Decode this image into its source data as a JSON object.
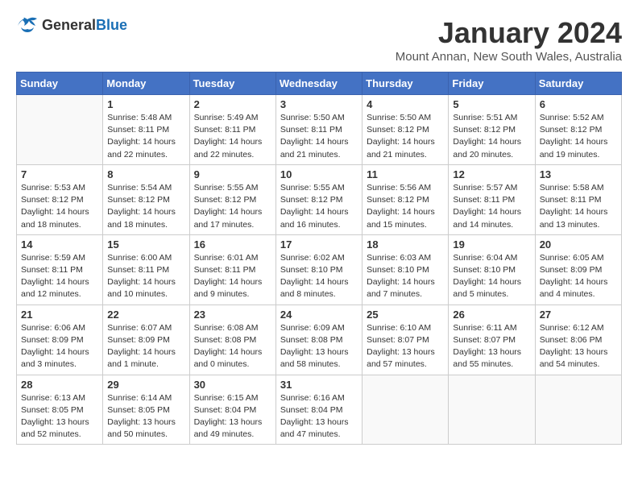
{
  "logo": {
    "general": "General",
    "blue": "Blue"
  },
  "title": "January 2024",
  "location": "Mount Annan, New South Wales, Australia",
  "days_of_week": [
    "Sunday",
    "Monday",
    "Tuesday",
    "Wednesday",
    "Thursday",
    "Friday",
    "Saturday"
  ],
  "weeks": [
    [
      {
        "day": "",
        "info": ""
      },
      {
        "day": "1",
        "info": "Sunrise: 5:48 AM\nSunset: 8:11 PM\nDaylight: 14 hours\nand 22 minutes."
      },
      {
        "day": "2",
        "info": "Sunrise: 5:49 AM\nSunset: 8:11 PM\nDaylight: 14 hours\nand 22 minutes."
      },
      {
        "day": "3",
        "info": "Sunrise: 5:50 AM\nSunset: 8:11 PM\nDaylight: 14 hours\nand 21 minutes."
      },
      {
        "day": "4",
        "info": "Sunrise: 5:50 AM\nSunset: 8:12 PM\nDaylight: 14 hours\nand 21 minutes."
      },
      {
        "day": "5",
        "info": "Sunrise: 5:51 AM\nSunset: 8:12 PM\nDaylight: 14 hours\nand 20 minutes."
      },
      {
        "day": "6",
        "info": "Sunrise: 5:52 AM\nSunset: 8:12 PM\nDaylight: 14 hours\nand 19 minutes."
      }
    ],
    [
      {
        "day": "7",
        "info": "Sunrise: 5:53 AM\nSunset: 8:12 PM\nDaylight: 14 hours\nand 18 minutes."
      },
      {
        "day": "8",
        "info": "Sunrise: 5:54 AM\nSunset: 8:12 PM\nDaylight: 14 hours\nand 18 minutes."
      },
      {
        "day": "9",
        "info": "Sunrise: 5:55 AM\nSunset: 8:12 PM\nDaylight: 14 hours\nand 17 minutes."
      },
      {
        "day": "10",
        "info": "Sunrise: 5:55 AM\nSunset: 8:12 PM\nDaylight: 14 hours\nand 16 minutes."
      },
      {
        "day": "11",
        "info": "Sunrise: 5:56 AM\nSunset: 8:12 PM\nDaylight: 14 hours\nand 15 minutes."
      },
      {
        "day": "12",
        "info": "Sunrise: 5:57 AM\nSunset: 8:11 PM\nDaylight: 14 hours\nand 14 minutes."
      },
      {
        "day": "13",
        "info": "Sunrise: 5:58 AM\nSunset: 8:11 PM\nDaylight: 14 hours\nand 13 minutes."
      }
    ],
    [
      {
        "day": "14",
        "info": "Sunrise: 5:59 AM\nSunset: 8:11 PM\nDaylight: 14 hours\nand 12 minutes."
      },
      {
        "day": "15",
        "info": "Sunrise: 6:00 AM\nSunset: 8:11 PM\nDaylight: 14 hours\nand 10 minutes."
      },
      {
        "day": "16",
        "info": "Sunrise: 6:01 AM\nSunset: 8:11 PM\nDaylight: 14 hours\nand 9 minutes."
      },
      {
        "day": "17",
        "info": "Sunrise: 6:02 AM\nSunset: 8:10 PM\nDaylight: 14 hours\nand 8 minutes."
      },
      {
        "day": "18",
        "info": "Sunrise: 6:03 AM\nSunset: 8:10 PM\nDaylight: 14 hours\nand 7 minutes."
      },
      {
        "day": "19",
        "info": "Sunrise: 6:04 AM\nSunset: 8:10 PM\nDaylight: 14 hours\nand 5 minutes."
      },
      {
        "day": "20",
        "info": "Sunrise: 6:05 AM\nSunset: 8:09 PM\nDaylight: 14 hours\nand 4 minutes."
      }
    ],
    [
      {
        "day": "21",
        "info": "Sunrise: 6:06 AM\nSunset: 8:09 PM\nDaylight: 14 hours\nand 3 minutes."
      },
      {
        "day": "22",
        "info": "Sunrise: 6:07 AM\nSunset: 8:09 PM\nDaylight: 14 hours\nand 1 minute."
      },
      {
        "day": "23",
        "info": "Sunrise: 6:08 AM\nSunset: 8:08 PM\nDaylight: 14 hours\nand 0 minutes."
      },
      {
        "day": "24",
        "info": "Sunrise: 6:09 AM\nSunset: 8:08 PM\nDaylight: 13 hours\nand 58 minutes."
      },
      {
        "day": "25",
        "info": "Sunrise: 6:10 AM\nSunset: 8:07 PM\nDaylight: 13 hours\nand 57 minutes."
      },
      {
        "day": "26",
        "info": "Sunrise: 6:11 AM\nSunset: 8:07 PM\nDaylight: 13 hours\nand 55 minutes."
      },
      {
        "day": "27",
        "info": "Sunrise: 6:12 AM\nSunset: 8:06 PM\nDaylight: 13 hours\nand 54 minutes."
      }
    ],
    [
      {
        "day": "28",
        "info": "Sunrise: 6:13 AM\nSunset: 8:05 PM\nDaylight: 13 hours\nand 52 minutes."
      },
      {
        "day": "29",
        "info": "Sunrise: 6:14 AM\nSunset: 8:05 PM\nDaylight: 13 hours\nand 50 minutes."
      },
      {
        "day": "30",
        "info": "Sunrise: 6:15 AM\nSunset: 8:04 PM\nDaylight: 13 hours\nand 49 minutes."
      },
      {
        "day": "31",
        "info": "Sunrise: 6:16 AM\nSunset: 8:04 PM\nDaylight: 13 hours\nand 47 minutes."
      },
      {
        "day": "",
        "info": ""
      },
      {
        "day": "",
        "info": ""
      },
      {
        "day": "",
        "info": ""
      }
    ]
  ]
}
